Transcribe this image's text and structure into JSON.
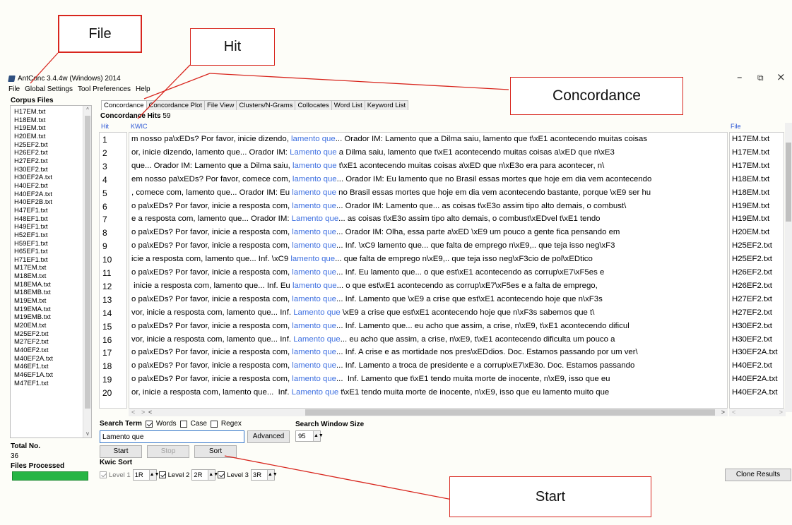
{
  "window": {
    "title": "AntConc 3.4.4w (Windows) 2014",
    "controls": {
      "minimize": "–",
      "maximize": "⧉",
      "close": "×"
    }
  },
  "menu": [
    "File",
    "Global Settings",
    "Tool Preferences",
    "Help"
  ],
  "corpus": {
    "heading": "Corpus Files",
    "files": [
      "H17EM.txt",
      "H18EM.txt",
      "H19EM.txt",
      "H20EM.txt",
      "H25EF2.txt",
      "H26EF2.txt",
      "H27EF2.txt",
      "H30EF2.txt",
      "H30EF2A.txt",
      "H40EF2.txt",
      "H40EF2A.txt",
      "H40EF2B.txt",
      "H47EF1.txt",
      "H48EF1.txt",
      "H49EF1.txt",
      "H52EF1.txt",
      "H59EF1.txt",
      "H65EF1.txt",
      "H71EF1.txt",
      "M17EM.txt",
      "M18EM.txt",
      "M18EMA.txt",
      "M18EMB.txt",
      "M19EM.txt",
      "M19EMA.txt",
      "M19EMB.txt",
      "M20EM.txt",
      "M25EF2.txt",
      "M27EF2.txt",
      "M40EF2.txt",
      "M40EF2A.txt",
      "M46EF1.txt",
      "M46EF1A.txt",
      "M47EF1.txt"
    ],
    "total_label": "Total No.",
    "total_value": "36",
    "files_processed_label": "Files Processed",
    "progress": 1.0
  },
  "tabs": [
    "Concordance",
    "Concordance Plot",
    "File View",
    "Clusters/N-Grams",
    "Collocates",
    "Word List",
    "Keyword List"
  ],
  "active_tab": "Concordance",
  "concordance": {
    "hits_label": "Concordance Hits",
    "hits_count": "59",
    "col_hit": "Hit",
    "col_kwic": "KWIC",
    "col_file": "File",
    "rows": [
      {
        "n": "1",
        "left": "m nosso pa\\xEDs? Por favor, inicie dizendo, ",
        "kw": "lamento que",
        "right": "... Orador IM: Lamento que a Dilma saiu, lamento que t\\xE1 acontecendo muitas coisas",
        "file": "H17EM.txt"
      },
      {
        "n": "2",
        "left": "or, inicie dizendo, lamento que... Orador IM: ",
        "kw": "Lamento que",
        "right": " a Dilma saiu, lamento que t\\xE1 acontecendo muitas coisas a\\xED que n\\xE3",
        "file": "H17EM.txt"
      },
      {
        "n": "3",
        "left": "que... Orador IM: Lamento que a Dilma saiu, ",
        "kw": "lamento que",
        "right": " t\\xE1 acontecendo muitas coisas a\\xED que n\\xE3o era para acontecer, n\\",
        "file": "H17EM.txt"
      },
      {
        "n": "4",
        "left": "em nosso pa\\xEDs? Por favor, comece com, ",
        "kw": "lamento que",
        "right": "... Orador IM: Eu lamento que no Brasil essas mortes que hoje em dia vem acontecendo",
        "file": "H18EM.txt"
      },
      {
        "n": "5",
        "left": ", comece com, lamento que... Orador IM: Eu ",
        "kw": "lamento que",
        "right": " no Brasil essas mortes que hoje em dia vem acontecendo bastante, porque \\xE9 ser hu",
        "file": "H18EM.txt"
      },
      {
        "n": "6",
        "left": "o pa\\xEDs? Por favor, inicie a resposta com, ",
        "kw": "lamento que",
        "right": "... Orador IM: Lamento que... as coisas t\\xE3o assim tipo alto demais, o combust\\",
        "file": "H19EM.txt"
      },
      {
        "n": "7",
        "left": "e a resposta com, lamento que... Orador IM: ",
        "kw": "Lamento que",
        "right": "... as coisas t\\xE3o assim tipo alto demais, o combust\\xEDvel t\\xE1 tendo",
        "file": "H19EM.txt"
      },
      {
        "n": "8",
        "left": "o pa\\xEDs? Por favor, inicie a resposta com, ",
        "kw": "lamento que",
        "right": "... Orador IM: Olha, essa parte a\\xED \\xE9 um pouco a gente fica pensando em",
        "file": "H20EM.txt"
      },
      {
        "n": "9",
        "left": "o pa\\xEDs? Por favor, inicie a resposta com, ",
        "kw": "lamento que",
        "right": "... Inf. \\xC9 lamento que... que falta de emprego n\\xE9,.. que teja isso neg\\xF3",
        "file": "H25EF2.txt"
      },
      {
        "n": "10",
        "left": "icie a resposta com, lamento que... Inf. \\xC9 ",
        "kw": "lamento que",
        "right": "... que falta de emprego n\\xE9,.. que teja isso neg\\xF3cio de pol\\xEDtico",
        "file": "H25EF2.txt"
      },
      {
        "n": "11",
        "left": "o pa\\xEDs? Por favor, inicie a resposta com, ",
        "kw": "lamento que",
        "right": "... Inf. Eu lamento que... o que est\\xE1 acontecendo as corrup\\xE7\\xF5es e",
        "file": "H26EF2.txt"
      },
      {
        "n": "12",
        "left": " inicie a resposta com, lamento que... Inf. Eu ",
        "kw": "lamento que",
        "right": "... o que est\\xE1 acontecendo as corrup\\xE7\\xF5es e a falta de emprego,",
        "file": "H26EF2.txt"
      },
      {
        "n": "13",
        "left": "o pa\\xEDs? Por favor, inicie a resposta com, ",
        "kw": "lamento que",
        "right": "... Inf. Lamento que \\xE9 a crise que est\\xE1 acontecendo hoje que n\\xF3s",
        "file": "H27EF2.txt"
      },
      {
        "n": "14",
        "left": "vor, inicie a resposta com, lamento que... Inf. ",
        "kw": "Lamento que",
        "right": " \\xE9 a crise que est\\xE1 acontecendo hoje que n\\xF3s sabemos que t\\",
        "file": "H27EF2.txt"
      },
      {
        "n": "15",
        "left": "o pa\\xEDs? Por favor, inicie a resposta com, ",
        "kw": "lamento que",
        "right": "... Inf. Lamento que... eu acho que assim, a crise, n\\xE9, t\\xE1 acontecendo dificul",
        "file": "H30EF2.txt"
      },
      {
        "n": "16",
        "left": "vor, inicie a resposta com, lamento que... Inf. ",
        "kw": "Lamento que",
        "right": "... eu acho que assim, a crise, n\\xE9, t\\xE1 acontecendo dificulta um pouco a",
        "file": "H30EF2.txt"
      },
      {
        "n": "17",
        "left": "o pa\\xEDs? Por favor, inicie a resposta com, ",
        "kw": "lamento que",
        "right": "... Inf. A crise e as mortidade nos pres\\xEDdios. Doc. Estamos passando por um ver\\",
        "file": "H30EF2A.txt"
      },
      {
        "n": "18",
        "left": "o pa\\xEDs? Por favor, inicie a resposta com, ",
        "kw": "lamento que",
        "right": "... Inf. Lamento a troca de presidente e a corrup\\xE7\\xE3o. Doc. Estamos passando",
        "file": "H40EF2.txt"
      },
      {
        "n": "19",
        "left": "o pa\\xEDs? Por favor, inicie a resposta com, ",
        "kw": "lamento que",
        "right": "...  Inf. Lamento que t\\xE1 tendo muita morte de inocente, n\\xE9, isso que eu",
        "file": "H40EF2A.txt"
      },
      {
        "n": "20",
        "left": "or, inicie a resposta com, lamento que...  Inf. ",
        "kw": "Lamento que",
        "right": " t\\xE1 tendo muita morte de inocente, n\\xE9, isso que eu lamento muito que",
        "file": "H40EF2A.txt"
      }
    ]
  },
  "search": {
    "term_label": "Search Term",
    "words_label": "Words",
    "case_label": "Case",
    "regex_label": "Regex",
    "words_checked": true,
    "case_checked": false,
    "regex_checked": false,
    "input_value": "Lamento que",
    "advanced_label": "Advanced",
    "window_size_label": "Search Window Size",
    "window_size_value": "95",
    "start_label": "Start",
    "stop_label": "Stop",
    "sort_label": "Sort"
  },
  "kwic_sort": {
    "label": "Kwic Sort",
    "level1_label": "Level 1",
    "level1_value": "1R",
    "level2_label": "Level 2",
    "level2_value": "2R",
    "level3_label": "Level 3",
    "level3_value": "3R"
  },
  "clone_label": "Clone Results",
  "annotations": {
    "file": "File",
    "hit": "Hit",
    "concordance": "Concordance",
    "start": "Start",
    "color": "#d8261e"
  },
  "colors": {
    "keyword": "#3d6fe0",
    "header_blue": "#2a55d4",
    "progress_green": "#26b544"
  }
}
